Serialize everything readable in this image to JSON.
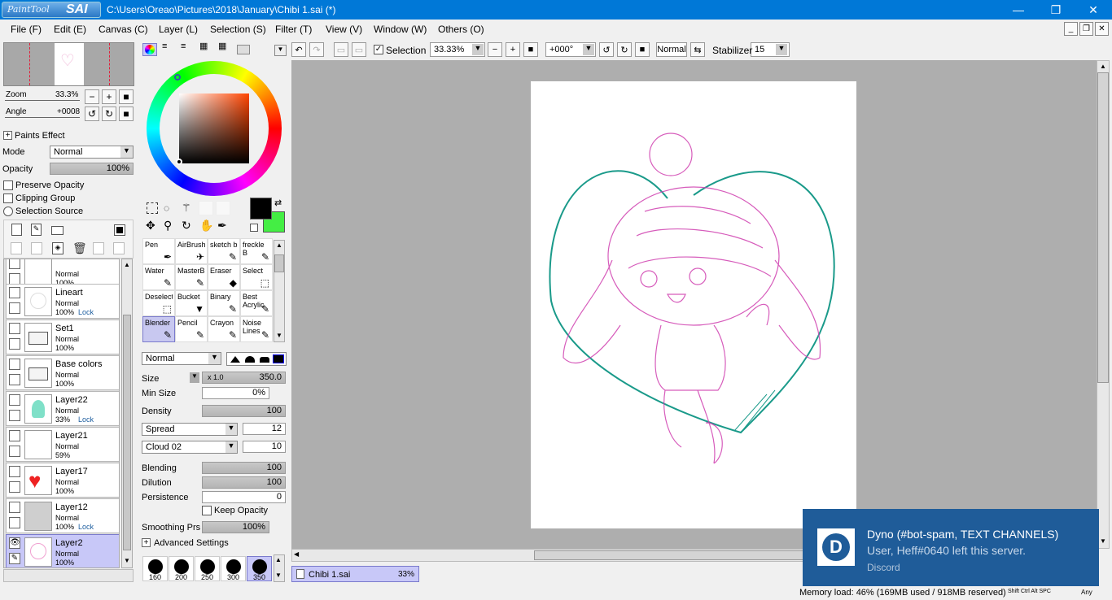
{
  "app": {
    "logo_brand": "PaintTool",
    "logo_name": "SAI",
    "window_title": "C:\\Users\\Oreao\\Pictures\\2018\\January\\Chibi 1.sai (*)"
  },
  "window_controls": {
    "minimize": "—",
    "maximize": "❐",
    "close": "✕"
  },
  "menu": [
    {
      "label": "File (F)"
    },
    {
      "label": "Edit (E)"
    },
    {
      "label": "Canvas (C)"
    },
    {
      "label": "Layer (L)"
    },
    {
      "label": "Selection (S)"
    },
    {
      "label": "Filter (T)"
    },
    {
      "label": "View (V)"
    },
    {
      "label": "Window (W)"
    },
    {
      "label": "Others (O)"
    }
  ],
  "navigator": {
    "zoom_label": "Zoom",
    "zoom_value": "33.3%",
    "angle_label": "Angle",
    "angle_value": "+0008"
  },
  "layer_props": {
    "paints_effect": "Paints Effect",
    "mode_label": "Mode",
    "mode_value": "Normal",
    "opacity_label": "Opacity",
    "opacity_value": "100%",
    "preserve_opacity": "Preserve Opacity",
    "clipping_group": "Clipping Group",
    "selection_source": "Selection Source"
  },
  "layers": [
    {
      "name": "",
      "mode": "Normal",
      "opacity": "100%",
      "lock": "",
      "thumb": "blank"
    },
    {
      "name": "Lineart",
      "mode": "Normal",
      "opacity": "100%",
      "lock": "Lock",
      "thumb": "sketch"
    },
    {
      "name": "Set1",
      "mode": "Normal",
      "opacity": "100%",
      "lock": "",
      "thumb": "folder"
    },
    {
      "name": "Base colors",
      "mode": "Normal",
      "opacity": "100%",
      "lock": "",
      "thumb": "folder"
    },
    {
      "name": "Layer22",
      "mode": "Normal",
      "opacity": "33%",
      "lock": "Lock",
      "thumb": "teal"
    },
    {
      "name": "Layer21",
      "mode": "Normal",
      "opacity": "59%",
      "lock": "",
      "thumb": "blank"
    },
    {
      "name": "Layer17",
      "mode": "Normal",
      "opacity": "100%",
      "lock": "",
      "thumb": "heart"
    },
    {
      "name": "Layer12",
      "mode": "Normal",
      "opacity": "100%",
      "lock": "Lock",
      "thumb": "gray"
    },
    {
      "name": "Layer2",
      "mode": "Normal",
      "opacity": "100%",
      "lock": "",
      "thumb": "pink",
      "selected": true
    }
  ],
  "colors": {
    "primary": "#000000",
    "secondary": "#44ee44",
    "accent_select": "#c8c8f8",
    "titlebar": "#0078d7"
  },
  "tools": [
    {
      "label": "Pen"
    },
    {
      "label": "AirBrush"
    },
    {
      "label": "sketch b"
    },
    {
      "label": "freckle B"
    },
    {
      "label": "Water"
    },
    {
      "label": "MasterB"
    },
    {
      "label": "Eraser"
    },
    {
      "label": "Select"
    },
    {
      "label": "Deselect"
    },
    {
      "label": "Bucket"
    },
    {
      "label": "Binary"
    },
    {
      "label": "Best Acrylic"
    },
    {
      "label": "Blender",
      "selected": true
    },
    {
      "label": "Pencil"
    },
    {
      "label": "Crayon"
    },
    {
      "label": "Noise Lines"
    }
  ],
  "brush": {
    "blend_mode": "Normal",
    "size_label": "Size",
    "size_mult": "x 1.0",
    "size_value": "350.0",
    "min_size_label": "Min Size",
    "min_size_value": "0%",
    "density_label": "Density",
    "density_value": "100",
    "spread_label": "Spread",
    "spread_value": "12",
    "texture_label": "Cloud 02",
    "texture_value": "10",
    "blending_label": "Blending",
    "blending_value": "100",
    "dilution_label": "Dilution",
    "dilution_value": "100",
    "persistence_label": "Persistence",
    "persistence_value": "0",
    "keep_opacity": "Keep Opacity",
    "smoothing_label": "Smoothing Prs",
    "smoothing_value": "100%",
    "advanced": "Advanced Settings",
    "sizes": [
      "160",
      "200",
      "250",
      "300",
      "350"
    ]
  },
  "toolbar": {
    "selection_label": "Selection",
    "zoom_value": "33.33%",
    "angle_value": "+000°",
    "blend_mode": "Normal",
    "stabilizer_label": "Stabilizer",
    "stabilizer_value": "15"
  },
  "doc_tab": {
    "name": "Chibi 1.sai",
    "zoom": "33%"
  },
  "status": {
    "memory": "Memory load: 46% (169MB used / 918MB reserved)",
    "keys": "Shift Ctrl Alt SPC",
    "wheel": "Any"
  },
  "notification": {
    "title": "Dyno (#bot-spam, TEXT CHANNELS)",
    "message": "User, Heff#0640 left this server.",
    "source": "Discord"
  }
}
